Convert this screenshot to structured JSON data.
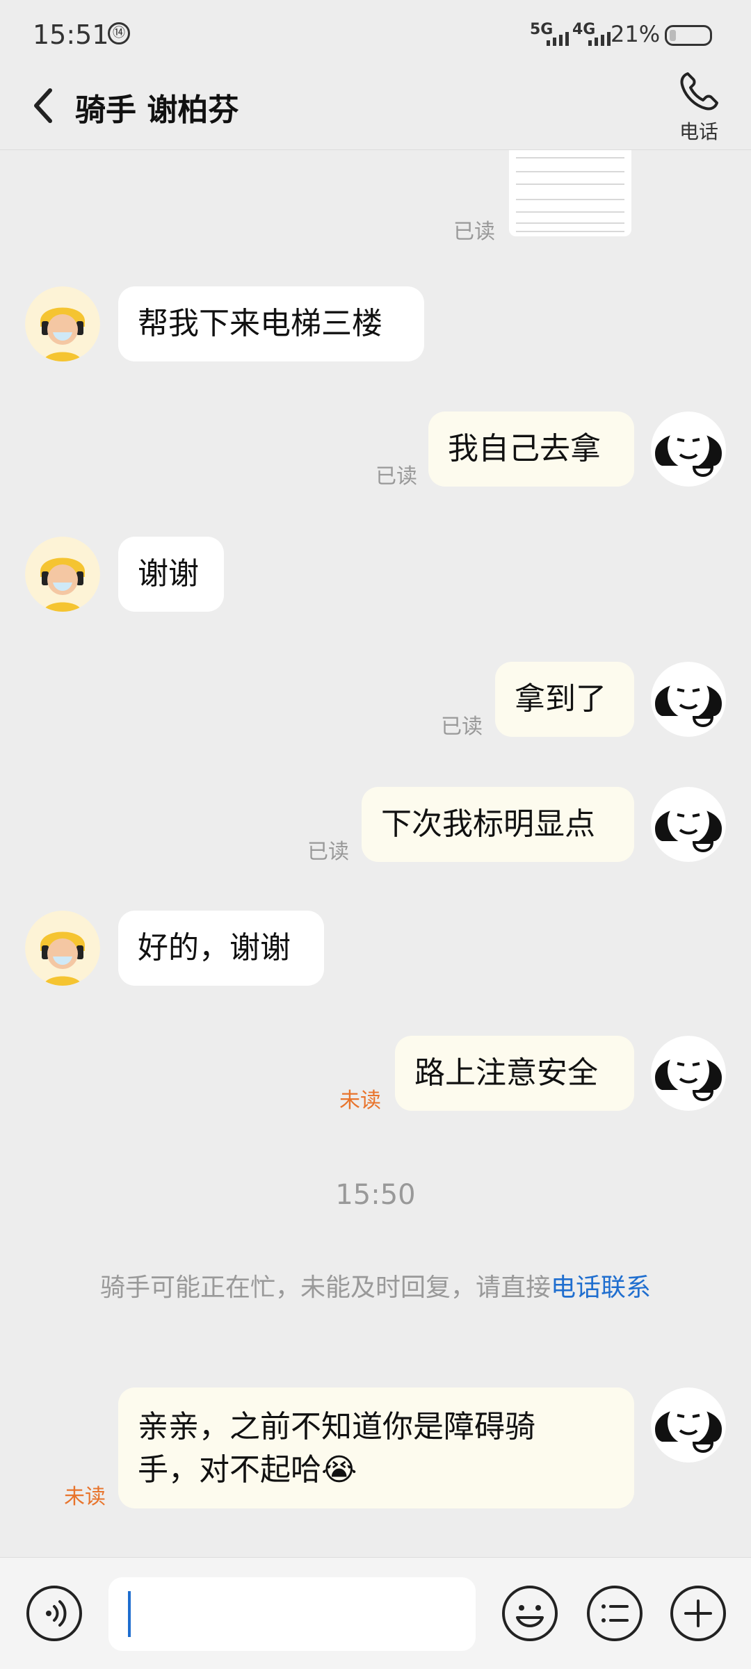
{
  "status": {
    "time": "15:51",
    "net1": "5G",
    "net2": "4G",
    "battery": "21%"
  },
  "header": {
    "title": "骑手 谢柏芬",
    "call_label": "电话"
  },
  "messages": {
    "m0_read": "已读",
    "m1": "帮我下来电梯三楼",
    "m2": "我自己去拿",
    "m2_read": "已读",
    "m3": "谢谢",
    "m4": "拿到了",
    "m4_read": "已读",
    "m5": "下次我标明显点",
    "m5_read": "已读",
    "m6": "好的，谢谢",
    "m7": "路上注意安全",
    "m7_unread": "未读",
    "time_divider": "15:50",
    "system_text": "骑手可能正在忙，未能及时回复，请直接",
    "system_link": "电话联系",
    "m8_line1": "亲亲，之前不知道你是障碍骑",
    "m8_line2": "手，对不起哈😭",
    "m8_unread": "未读"
  },
  "colors": {
    "link": "#1f6ecf",
    "unread": "#e8742c",
    "right_bubble": "#fdfbee"
  }
}
